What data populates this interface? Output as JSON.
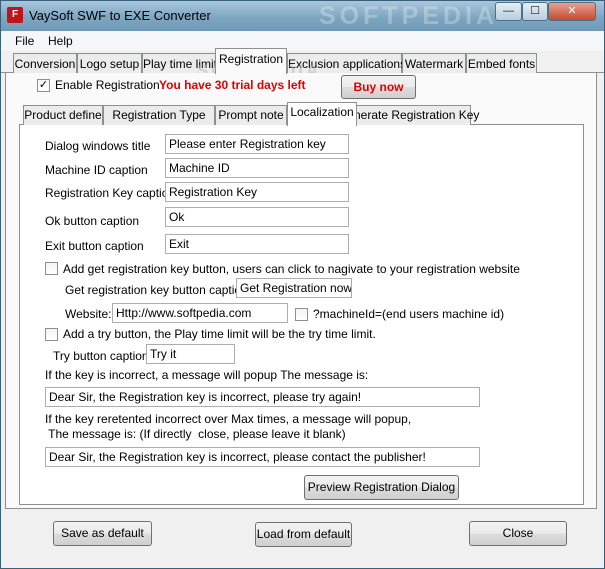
{
  "window": {
    "title": "VaySoft SWF to EXE Converter",
    "watermark": "SOFTPEDIA",
    "min_glyph": "—",
    "max_glyph": "☐",
    "close_glyph": "✕"
  },
  "menu": [
    "File",
    "Help"
  ],
  "tabs": [
    "Conversion",
    "Logo setup",
    "Play time limit",
    "Registration",
    "Exclusion applications",
    "Watermark",
    "Embed fonts"
  ],
  "registration": {
    "enable_label": "Enable Registration",
    "enable_checked": "✓",
    "trial_text": "You have 30 trial days left",
    "buy_label": "Buy now"
  },
  "subtabs": [
    "Product define",
    "Registration Type",
    "Prompt note",
    "Localization",
    "Generate Registration Key"
  ],
  "localization": {
    "dialog_title_label": "Dialog windows title",
    "dialog_title_value": "Please enter Registration key",
    "machine_id_label": "Machine ID caption",
    "machine_id_value": "Machine ID",
    "reg_key_label": "Registration Key caption",
    "reg_key_value": "Registration Key",
    "ok_label": "Ok button caption",
    "ok_value": "Ok",
    "exit_label": "Exit button caption",
    "exit_value": "Exit",
    "add_getkey_label": "Add get registration key button, users can click to nagivate to your registration website",
    "getkey_caption_label": "Get registration key button caption:",
    "getkey_caption_value": "Get Registration now!",
    "website_label": "Website:",
    "website_value": "Http://www.softpedia.com",
    "machineid_param_label": "?machineId=(end users machine id)",
    "add_try_label": "Add a try button, the Play time limit will be the try time limit.",
    "try_caption_label": "Try button caption:",
    "try_caption_value": "Try it",
    "incorrect_msg_label": "If the key is incorrect, a message will popup The message is:",
    "incorrect_msg_value": "Dear Sir, the Registration key is incorrect, please try again!",
    "max_msg_label_1": "If the key reretented incorrect over Max times, a message will popup,",
    "max_msg_label_2": " The message is: (If directly  close, please leave it blank)",
    "max_msg_value": "Dear Sir, the Registration key is incorrect, please contact the publisher!",
    "preview_button": "Preview Registration Dialog"
  },
  "footer": {
    "save_default": "Save as default",
    "load_default": "Load from default",
    "close": "Close"
  }
}
